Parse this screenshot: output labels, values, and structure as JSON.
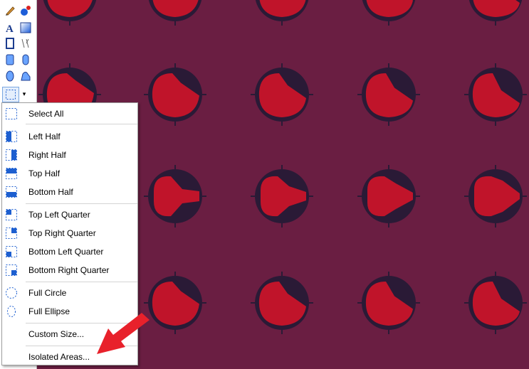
{
  "colors": {
    "background": "#6a1e42",
    "ring": "#2a1a36",
    "fill": "#c0142a",
    "arrow": "#e8212b"
  },
  "toolbox": {
    "tools": [
      "pencil-icon",
      "color-picker-icon",
      "text-icon",
      "gradient-icon",
      "rectangle-outline-icon",
      "line-icon",
      "rounded-rect-icon",
      "capsule-icon",
      "ellipse-icon",
      "freeform-shape-icon",
      "rect-select-icon"
    ]
  },
  "menu": {
    "items": [
      {
        "label": "Select All",
        "icon": "select-all-icon"
      },
      {
        "label": "Left Half",
        "icon": "left-half-icon"
      },
      {
        "label": "Right Half",
        "icon": "right-half-icon"
      },
      {
        "label": "Top Half",
        "icon": "top-half-icon"
      },
      {
        "label": "Bottom Half",
        "icon": "bottom-half-icon"
      },
      {
        "label": "Top Left Quarter",
        "icon": "top-left-quarter-icon"
      },
      {
        "label": "Top Right Quarter",
        "icon": "top-right-quarter-icon"
      },
      {
        "label": "Bottom Left Quarter",
        "icon": "bottom-left-quarter-icon"
      },
      {
        "label": "Bottom Right Quarter",
        "icon": "bottom-right-quarter-icon"
      },
      {
        "label": "Full Circle",
        "icon": "full-circle-icon"
      },
      {
        "label": "Full Ellipse",
        "icon": "full-ellipse-icon"
      },
      {
        "label": "Custom Size...",
        "icon": ""
      },
      {
        "label": "Isolated Areas...",
        "icon": ""
      }
    ]
  }
}
